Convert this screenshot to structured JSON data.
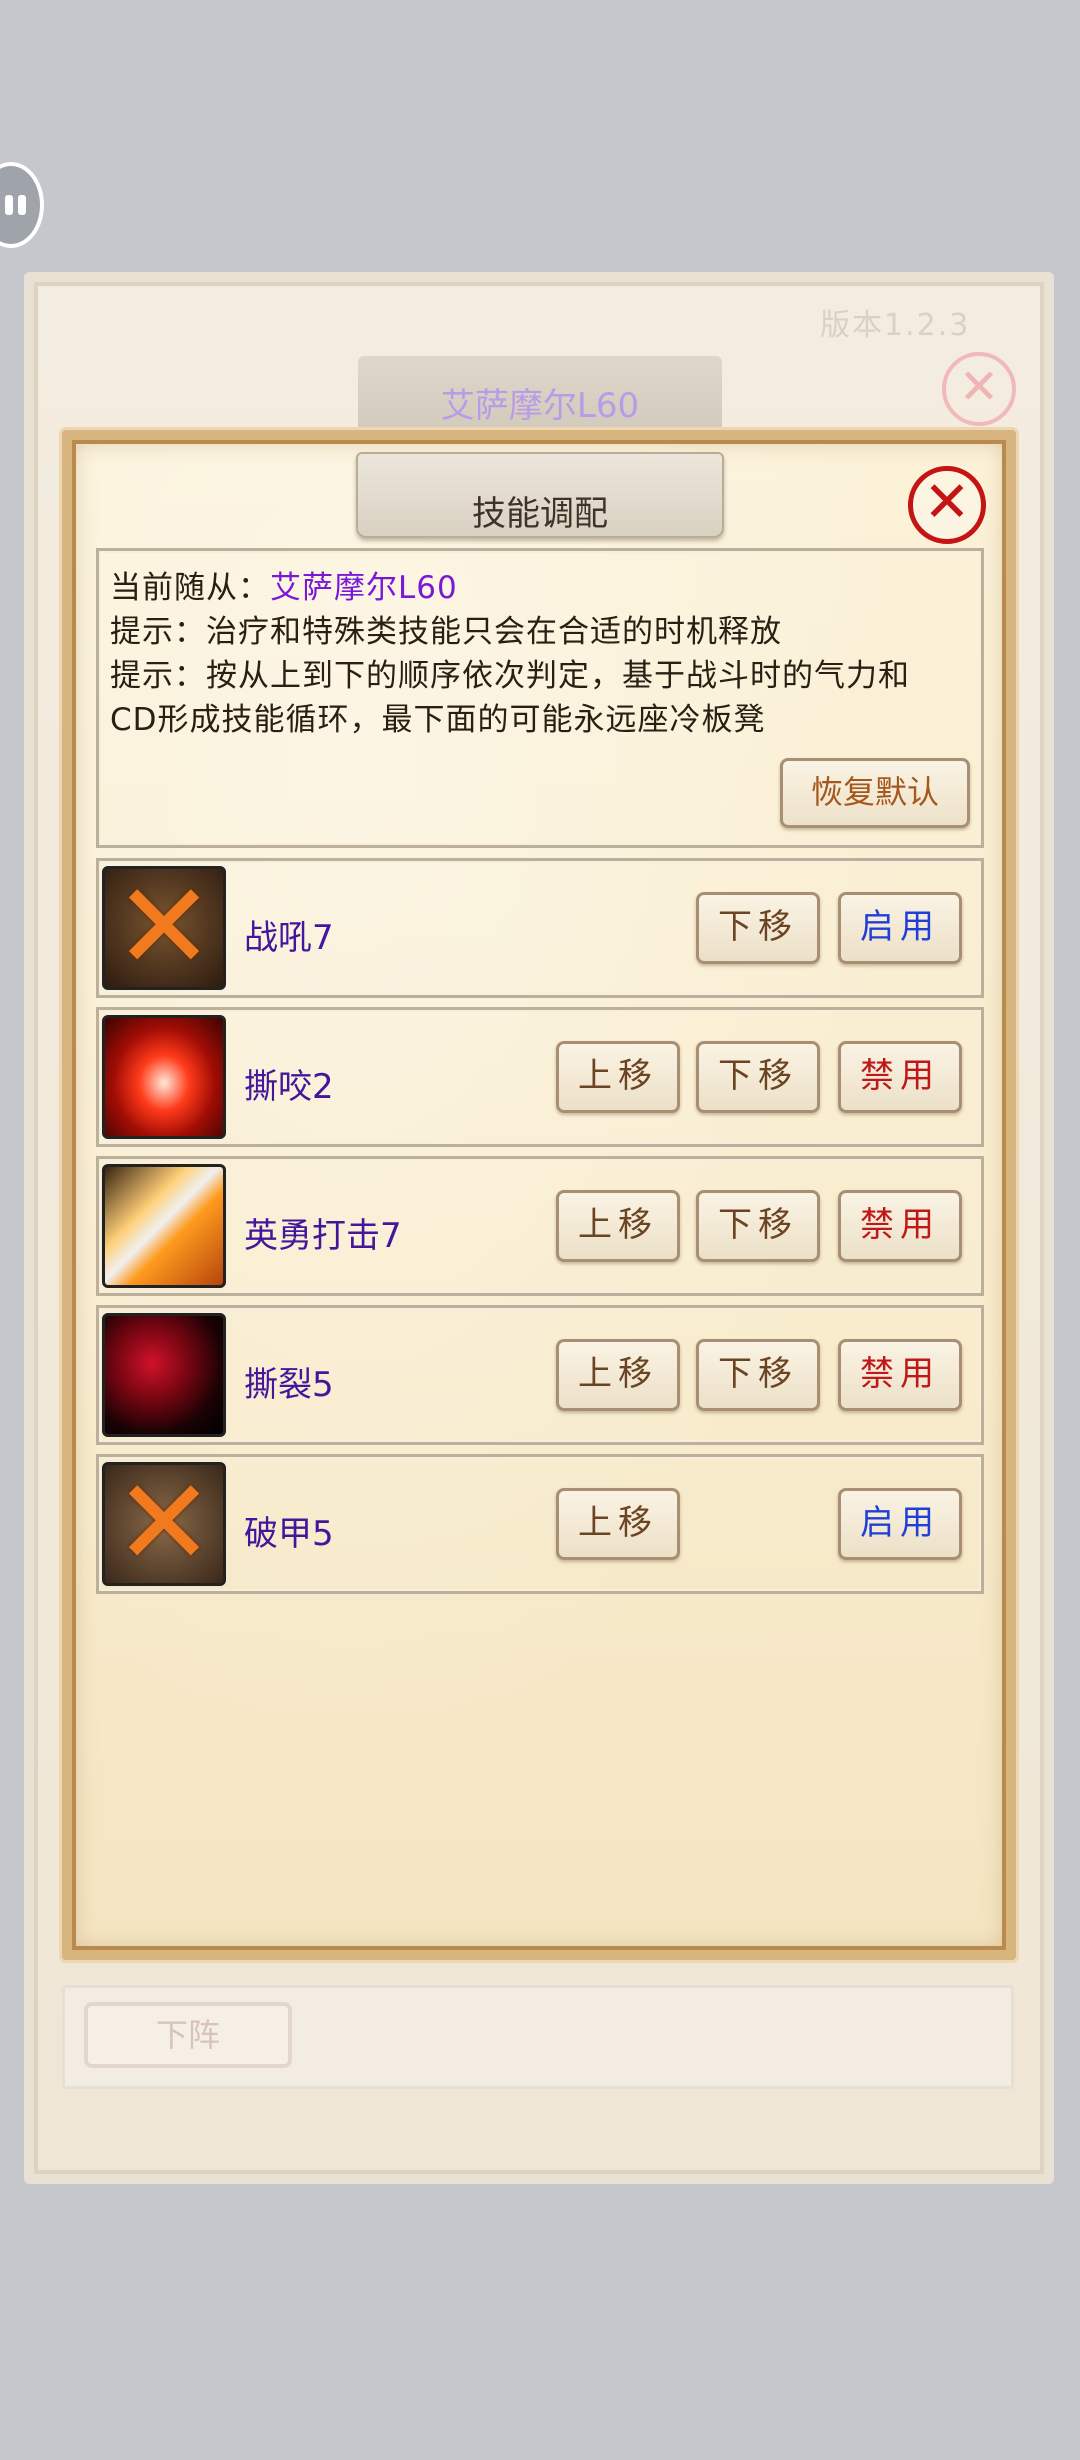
{
  "back_window": {
    "version_text": "版本1.2.3",
    "title": "艾萨摩尔L60",
    "close_icon": "close-icon",
    "bottom_button": "下阵"
  },
  "dialog": {
    "title": "技能调配",
    "close_icon": "close-icon",
    "current_follower_label": "当前随从：",
    "current_follower_name": "艾萨摩尔L60",
    "hint1": "提示：治疗和特殊类技能只会在合适的时机释放",
    "hint2_line1": "提示：按从上到下的顺序依次判定，基于战斗时的气力和",
    "hint2_line2": "CD形成技能循环，最下面的可能永远座冷板凳",
    "restore_default": "恢复默认"
  },
  "buttons": {
    "move_up": "上移",
    "move_down": "下移",
    "enable": "启用",
    "disable": "禁用"
  },
  "skills": [
    {
      "name": "战吼7",
      "icon": "battle-shout-icon-disabled",
      "state": "disabled"
    },
    {
      "name": "撕咬2",
      "icon": "bite-fangs-icon",
      "state": "enabled"
    },
    {
      "name": "英勇打击7",
      "icon": "heroic-strike-blade-icon",
      "state": "enabled"
    },
    {
      "name": "撕裂5",
      "icon": "rend-claw-icon",
      "state": "enabled"
    },
    {
      "name": "破甲5",
      "icon": "sunder-armor-icon-disabled",
      "state": "disabled"
    }
  ],
  "colors": {
    "skill_name": "#44169c",
    "enable_text": "#1f3fd6",
    "disable_text": "#c01818",
    "follower_name": "#7a18d8"
  }
}
